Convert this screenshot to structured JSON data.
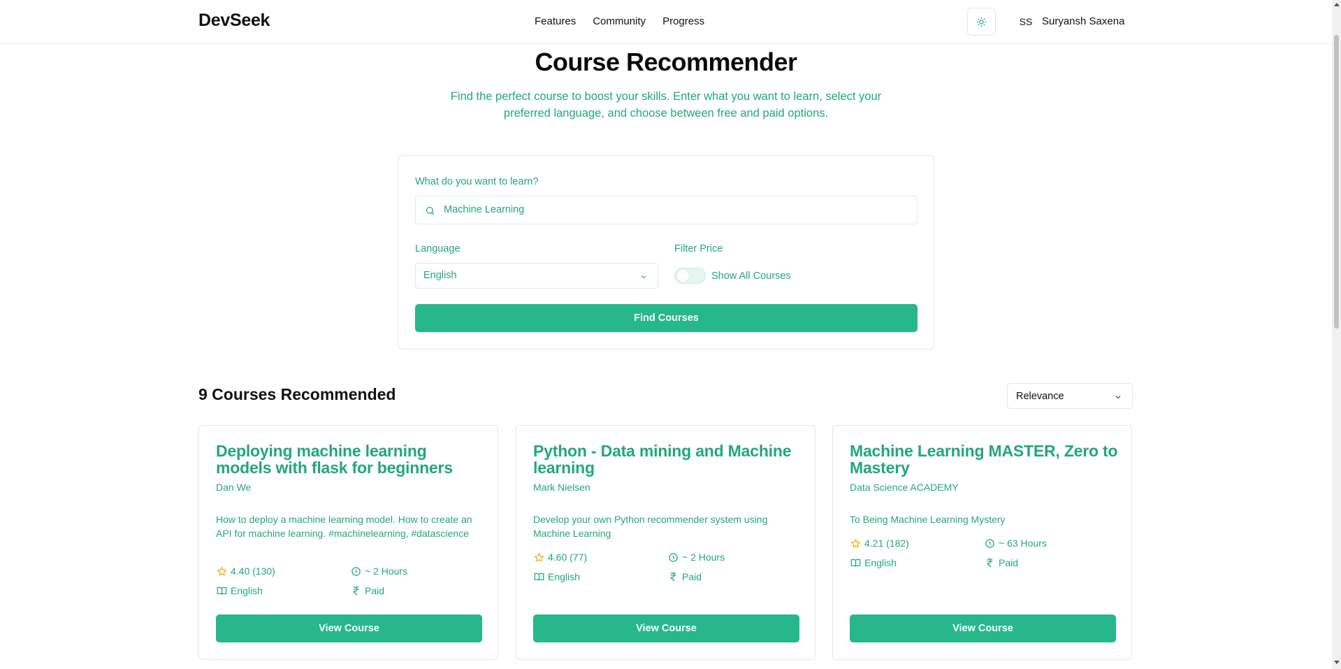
{
  "header": {
    "brand": "DevSeek",
    "nav": [
      "Features",
      "Community",
      "Progress"
    ],
    "avatar_initials": "SS",
    "user_name": "Suryansh Saxena"
  },
  "hero": {
    "title": "Course Recommender",
    "subtitle": "Find the perfect course to boost your skills. Enter what you want to learn, select your preferred language, and choose between free and paid options."
  },
  "search": {
    "label": "What do you want to learn?",
    "value": "Machine Learning",
    "language_label": "Language",
    "language_value": "English",
    "price_label": "Filter Price",
    "toggle_label": "Show All Courses",
    "find_button": "Find Courses"
  },
  "results": {
    "title": "9 Courses Recommended",
    "sort_value": "Relevance",
    "view_button": "View Course",
    "courses": [
      {
        "title": "Deploying machine learning models with flask for beginners",
        "author": "Dan We",
        "description": "How to deploy a machine learning model. How to create an API for machine learning. #machinelearning, #datascience",
        "rating": "4.40 (130)",
        "duration": "~ 2 Hours",
        "language": "English",
        "price": "Paid"
      },
      {
        "title": "Python - Data mining and Machine learning",
        "author": "Mark Nielsen",
        "description": "Develop your own Python recommender system using Machine Learning",
        "rating": "4.60 (77)",
        "duration": "~ 2 Hours",
        "language": "English",
        "price": "Paid"
      },
      {
        "title": "Machine Learning MASTER, Zero to Mastery",
        "author": "Data Science ACADEMY",
        "description": "To Being Machine Learning Mystery",
        "rating": "4.21 (182)",
        "duration": "~ 63 Hours",
        "language": "English",
        "price": "Paid"
      }
    ]
  },
  "colors": {
    "accent": "#26b88a",
    "accent_text": "#22a77a",
    "star": "#eab308"
  }
}
